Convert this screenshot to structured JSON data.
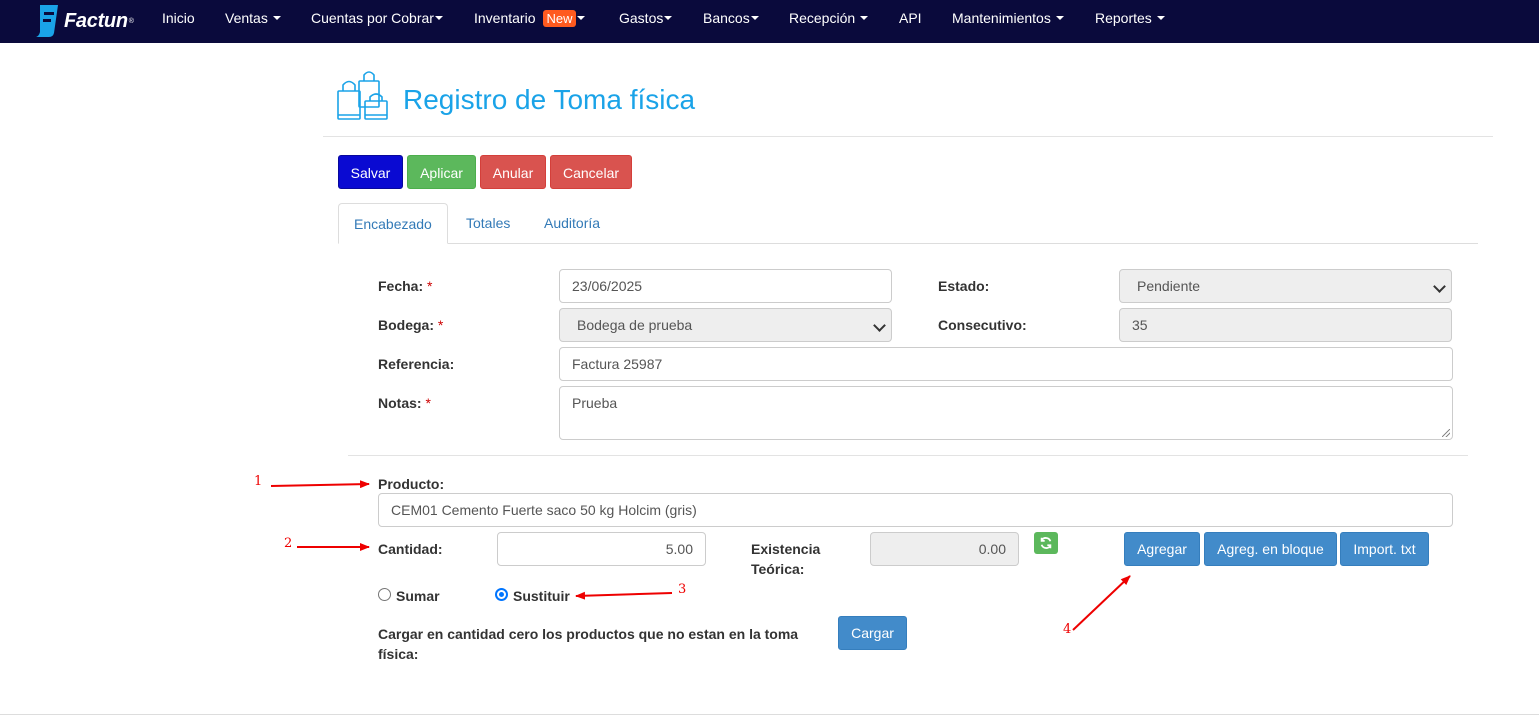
{
  "nav": {
    "logo_text": "Factun",
    "logo_reg": "®",
    "items": [
      {
        "label": "Inicio"
      },
      {
        "label": "Ventas"
      },
      {
        "label": "Cuentas por Cobrar"
      },
      {
        "label": "Inventario",
        "badge": "New"
      },
      {
        "label": "Gastos"
      },
      {
        "label": "Bancos"
      },
      {
        "label": "Recepción"
      },
      {
        "label": "API"
      },
      {
        "label": "Mantenimientos"
      },
      {
        "label": "Reportes"
      }
    ]
  },
  "page": {
    "title": "Registro de Toma física"
  },
  "actions": {
    "save": "Salvar",
    "apply": "Aplicar",
    "annul": "Anular",
    "cancel": "Cancelar"
  },
  "tabs": [
    {
      "label": "Encabezado"
    },
    {
      "label": "Totales"
    },
    {
      "label": "Auditoría"
    }
  ],
  "form": {
    "required_mark": "*",
    "fecha": {
      "label": "Fecha:",
      "value": "23/06/2025"
    },
    "estado": {
      "label": "Estado:",
      "value": "Pendiente"
    },
    "bodega": {
      "label": "Bodega:",
      "value": "Bodega de prueba"
    },
    "consecutivo": {
      "label": "Consecutivo:",
      "value": "35"
    },
    "referencia": {
      "label": "Referencia:",
      "value": "Factura 25987"
    },
    "notas": {
      "label": "Notas:",
      "value": "Prueba"
    }
  },
  "product": {
    "label": "Producto:",
    "value": "CEM01 Cemento Fuerte saco 50 kg Holcim (gris)",
    "cantidad_label": "Cantidad:",
    "cantidad_value": "5.00",
    "existencia_label_1": "Existencia",
    "existencia_label_2": "Teórica:",
    "existencia_value": "0.00",
    "add": "Agregar",
    "add_bulk": "Agreg. en bloque",
    "import_txt": "Import. txt",
    "sumar": "Sumar",
    "sustituir": "Sustituir",
    "mode_selected": "Sustituir",
    "cargar_text_1": "Cargar en cantidad cero los productos que no estan en la toma",
    "cargar_text_2": "física:",
    "cargar_btn": "Cargar"
  },
  "annotations": [
    "1",
    "2",
    "3",
    "4"
  ],
  "colors": {
    "navbar": "#0a0a3c",
    "title": "#1aa3e8",
    "save": "#0a0ad2",
    "apply": "#5cb85c",
    "danger": "#d9534f",
    "primary": "#428bca",
    "badge": "#ff5a1f",
    "annotation": "#e00000"
  }
}
